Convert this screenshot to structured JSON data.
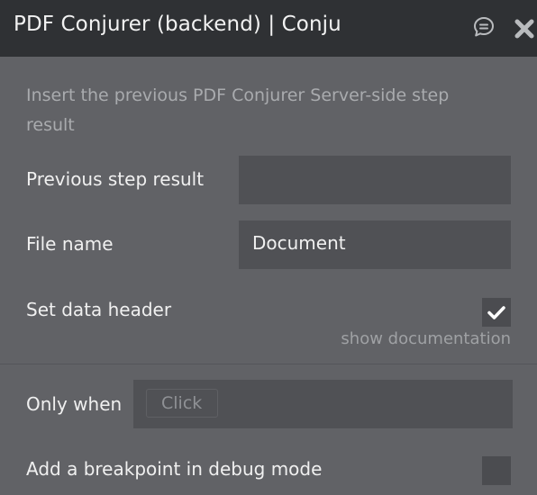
{
  "header": {
    "title": "PDF Conjurer (backend) | Conju",
    "comment_icon": "comment-icon",
    "close_icon": "close-icon"
  },
  "description": "Insert the previous PDF Conjurer Server-side step result",
  "fields": {
    "previous_step_result": {
      "label": "Previous step result",
      "value": ""
    },
    "file_name": {
      "label": "File name",
      "value": "Document"
    },
    "set_data_header": {
      "label": "Set data header",
      "checked": true
    },
    "show_documentation": "show documentation"
  },
  "only_when": {
    "label": "Only when",
    "chip": "Click"
  },
  "breakpoint": {
    "label": "Add a breakpoint in debug mode",
    "checked": false
  },
  "colors": {
    "panel_bg": "#616266",
    "header_bg": "#2f3134",
    "field_bg": "#505155"
  }
}
